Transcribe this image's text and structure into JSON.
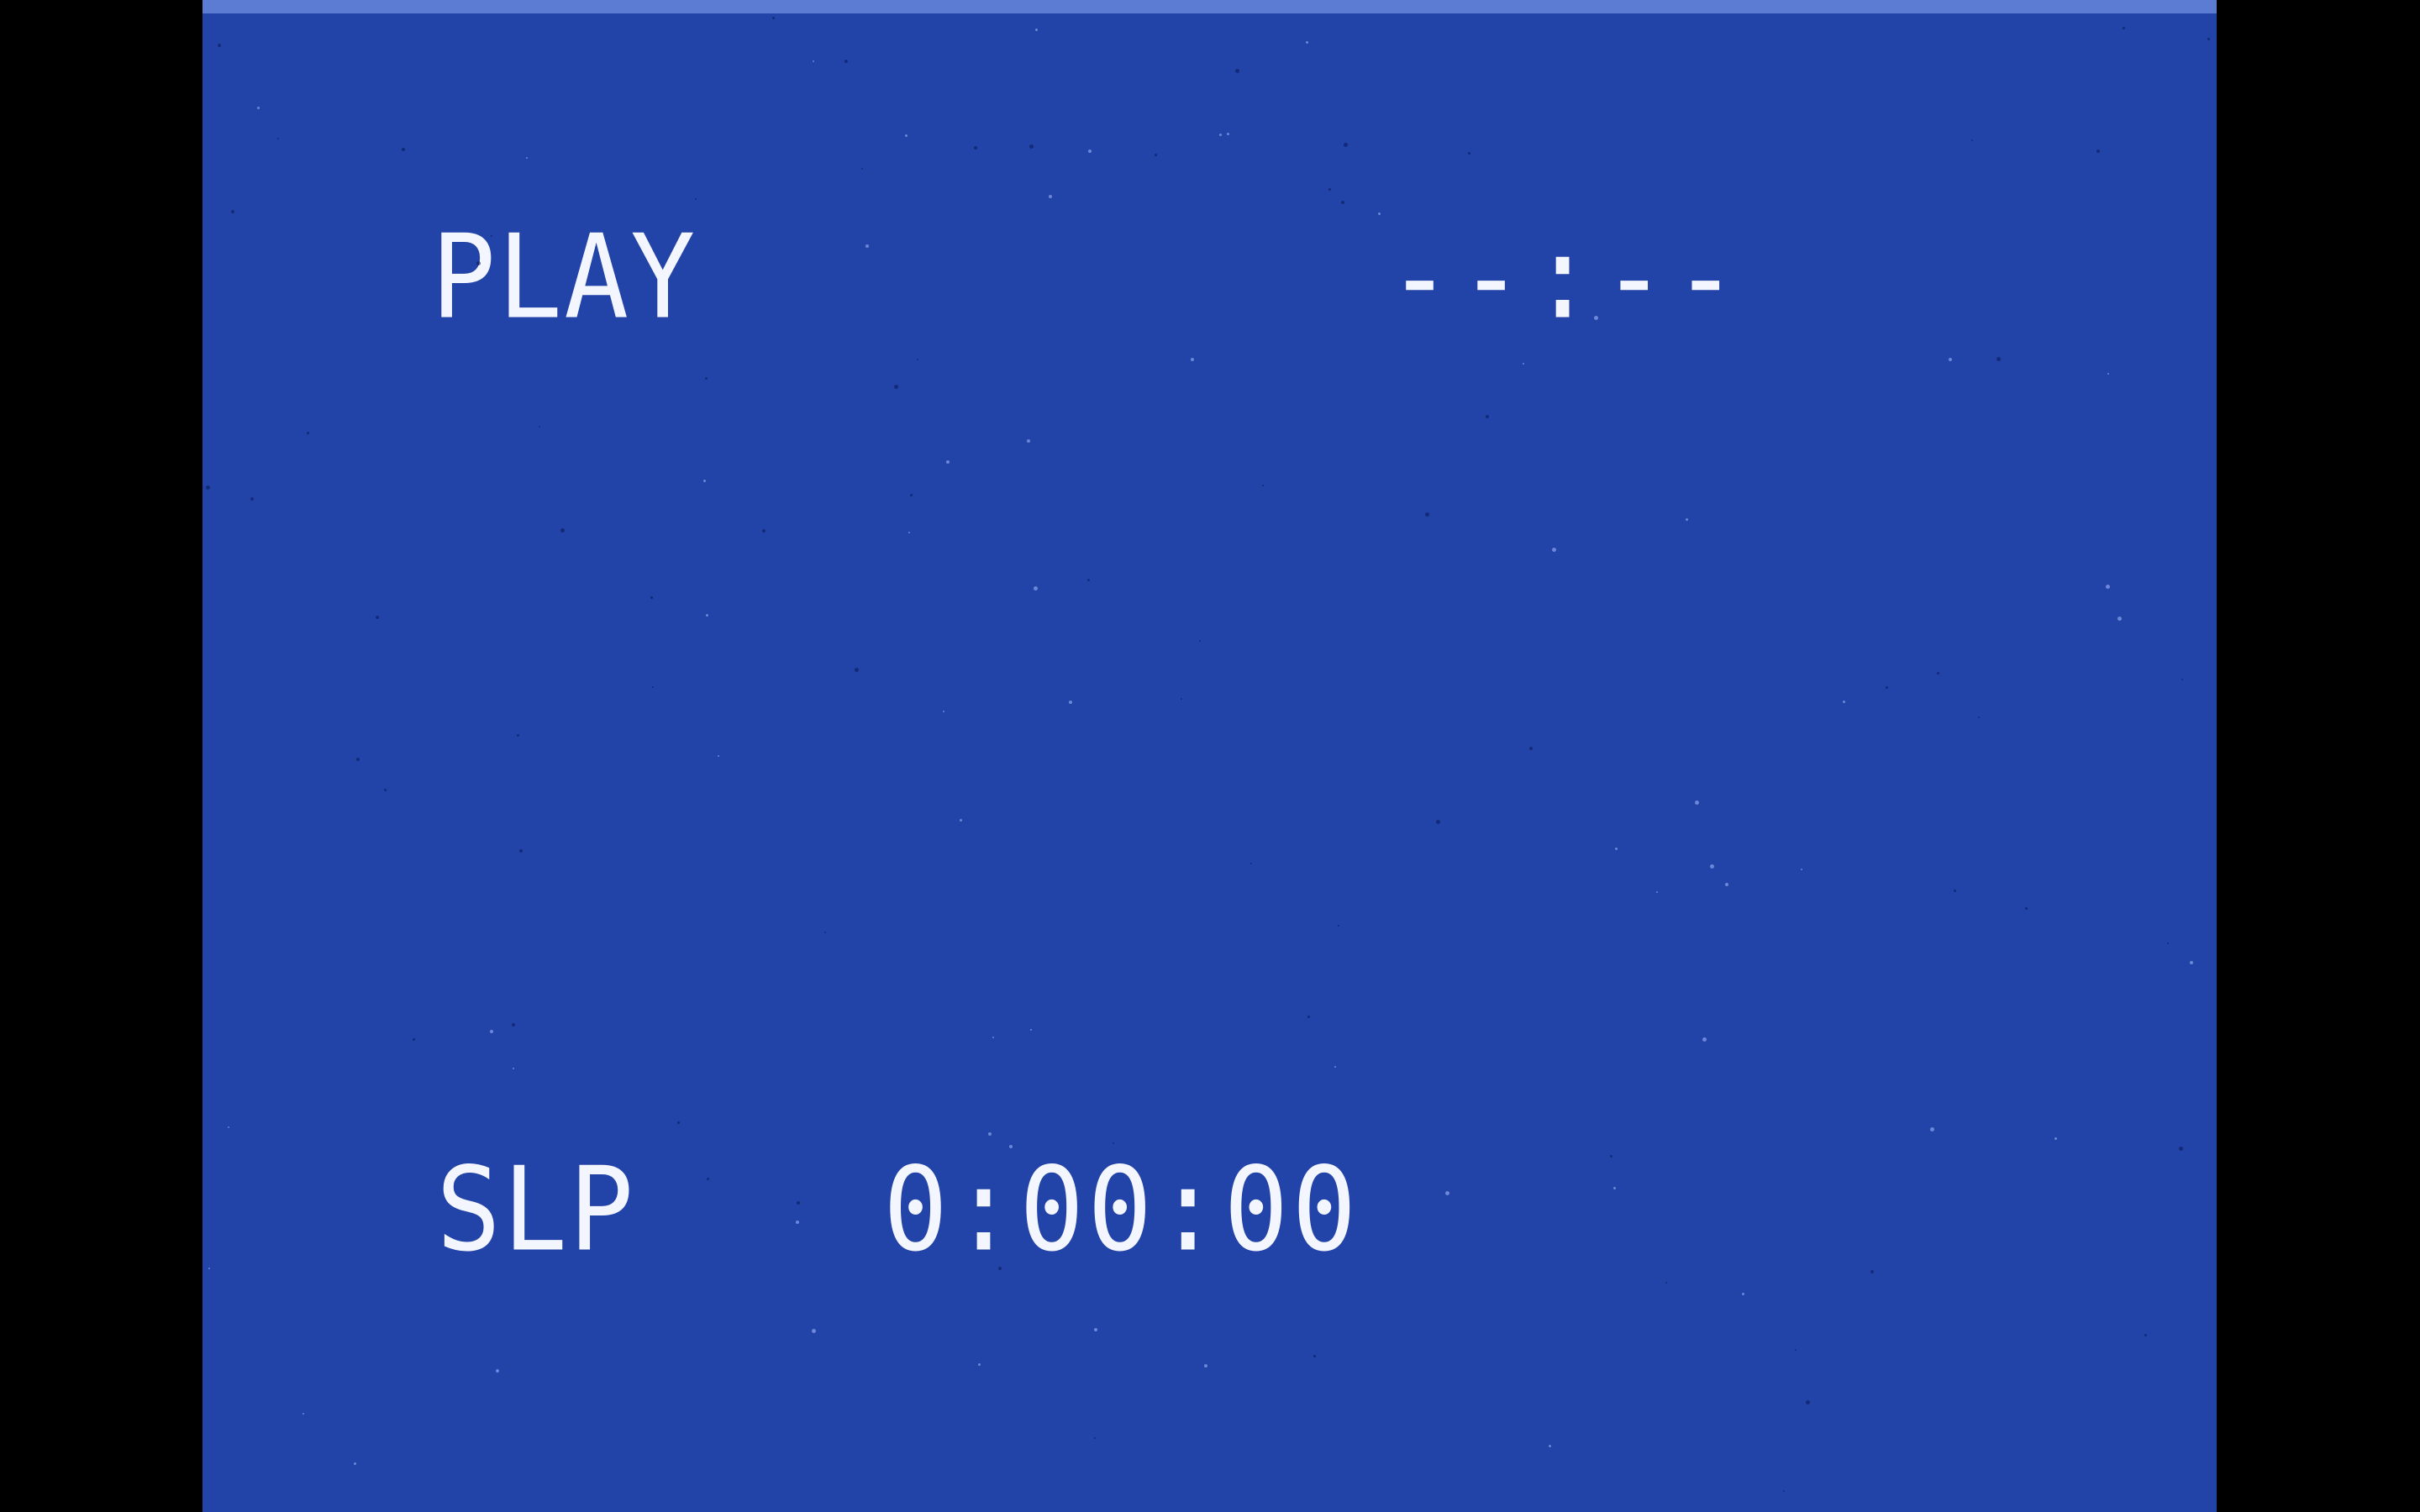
{
  "osd": {
    "mode": "PLAY",
    "clock": "--:--",
    "tape_speed": "SLP",
    "counter": "0:00:00"
  },
  "colors": {
    "screen_background": "#2244a8",
    "osd_text": "#f4f6ff",
    "letterbox": "#000000"
  }
}
